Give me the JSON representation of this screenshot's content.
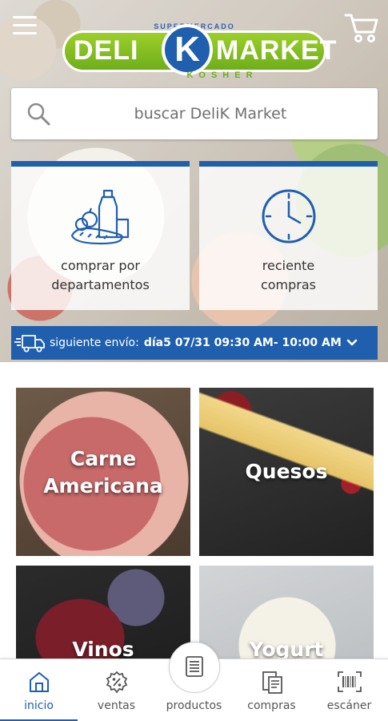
{
  "header": {
    "menu_icon": "hamburger-menu-icon",
    "cart_icon": "shopping-cart-icon",
    "logo": {
      "super": "SUPERMERCADO",
      "left": "DELI",
      "k": "K",
      "right": "MARKET",
      "sub": "KOSHER"
    }
  },
  "search": {
    "placeholder": "buscar DeliK Market",
    "icon": "search-icon"
  },
  "tiles": [
    {
      "label_line1": "comprar por",
      "label_line2": "departamentos",
      "icon": "groceries-icon"
    },
    {
      "label_line1": "reciente",
      "label_line2": "compras",
      "icon": "clock-icon"
    }
  ],
  "delivery": {
    "label": "siguiente envío:",
    "value": "día5 07/31 09:30 AM- 10:00 AM",
    "icon": "delivery-truck-icon"
  },
  "categories": [
    {
      "label_line1": "Carne",
      "label_line2": "Americana"
    },
    {
      "label": "Quesos"
    },
    {
      "label": "Vinos"
    },
    {
      "label": "Yogurt"
    }
  ],
  "bottom_nav": [
    {
      "label": "inicio",
      "icon": "home-icon",
      "active": true
    },
    {
      "label": "ventas",
      "icon": "percent-badge-icon"
    },
    {
      "label": "productos",
      "icon": "list-icon"
    },
    {
      "label": "compras",
      "icon": "receipt-icon"
    },
    {
      "label": "escáner",
      "icon": "barcode-scanner-icon"
    }
  ],
  "colors": {
    "brand_blue": "#1f5fae",
    "brand_green": "#7ab929"
  }
}
